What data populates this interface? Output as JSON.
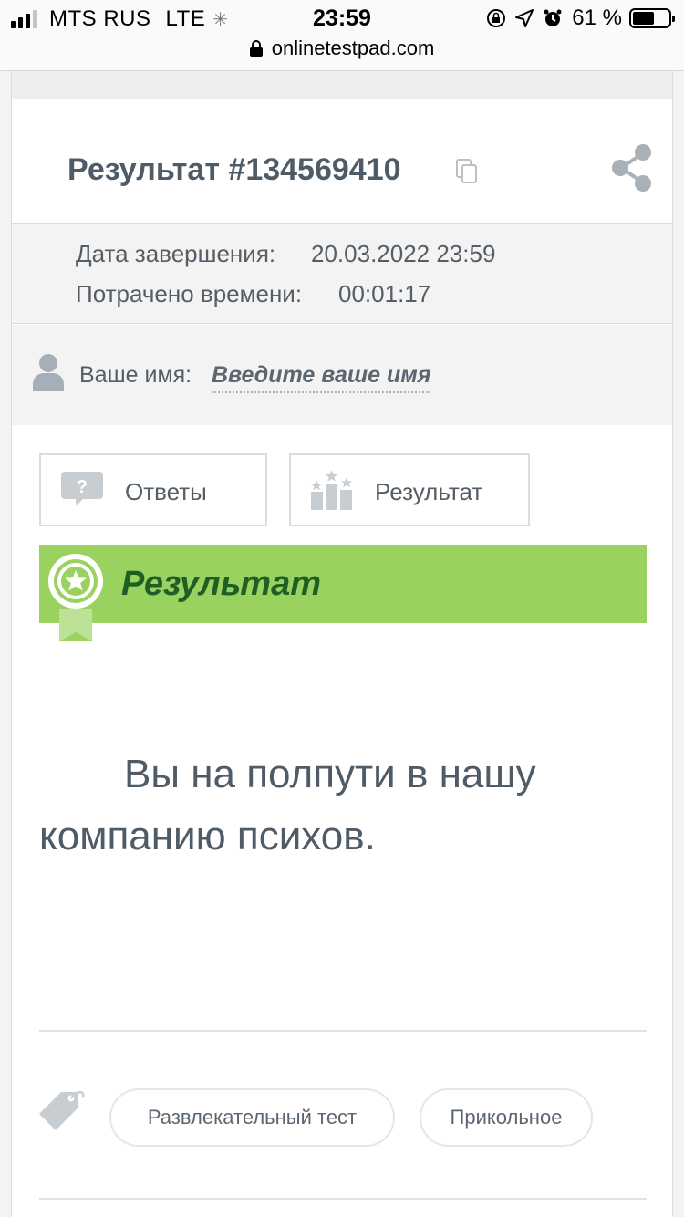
{
  "status_bar": {
    "carrier": "MTS RUS",
    "network": "LTE",
    "time": "23:59",
    "battery_percent": "61 %",
    "battery_level": 0.61,
    "icons": [
      "signal-icon",
      "loading-spinner-icon",
      "screen-lock-icon",
      "location-arrow-icon",
      "alarm-icon",
      "battery-icon"
    ]
  },
  "browser": {
    "url": "onlinetestpad.com"
  },
  "result": {
    "title": "Результат #134569410",
    "completion_label": "Дата завершения:",
    "completion_value": "20.03.2022 23:59",
    "time_spent_label": "Потрачено времени:",
    "time_spent_value": "00:01:17",
    "name_label": "Ваше имя:",
    "name_link": "Введите ваше имя"
  },
  "tabs": [
    {
      "label": "Ответы",
      "icon": "question-bubble-icon"
    },
    {
      "label": "Результат",
      "icon": "podium-stars-icon"
    }
  ],
  "banner": {
    "title": "Результат",
    "icon": "award-badge-icon",
    "color": "#9ad25f"
  },
  "result_text": "Вы на полпути в нашу компанию психов.",
  "tags": [
    {
      "label": "Развлекательный тест"
    },
    {
      "label": "Прикольное"
    }
  ]
}
